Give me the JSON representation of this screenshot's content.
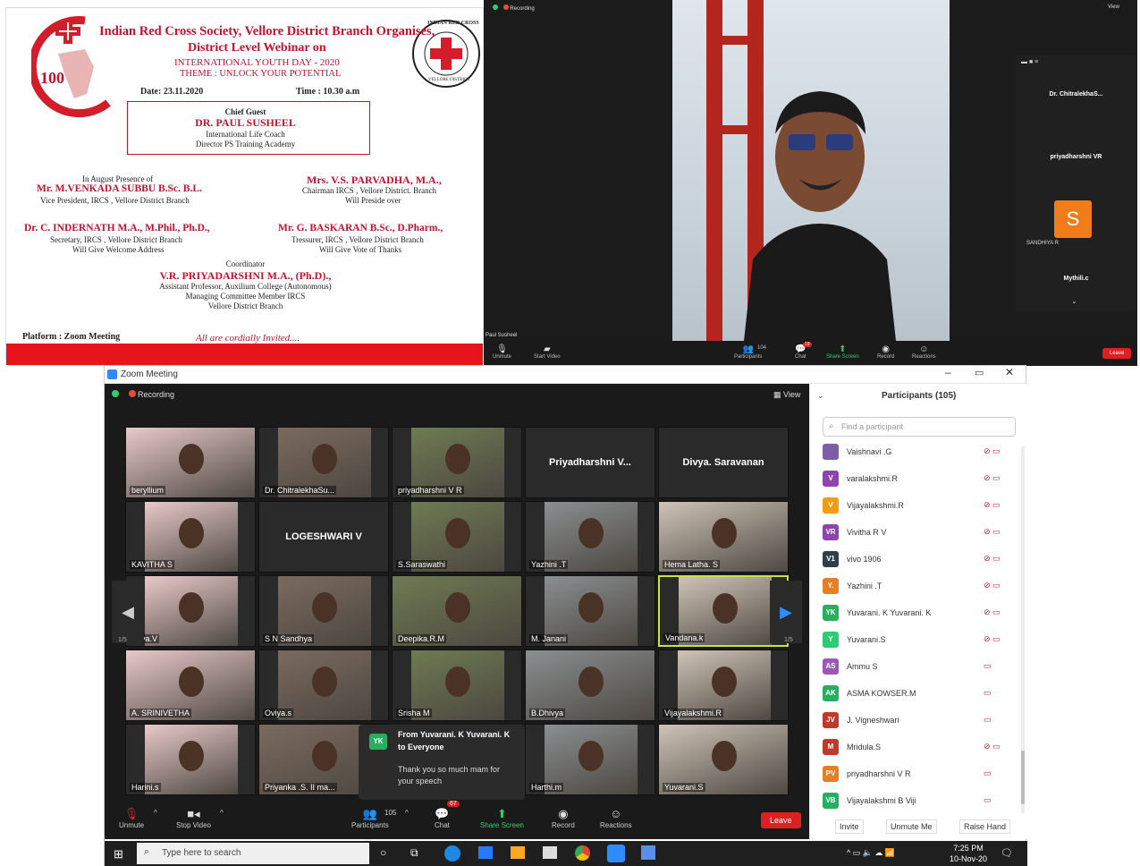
{
  "invitation": {
    "title_line1": "Indian Red Cross Society, Vellore District Branch Organises,",
    "title_line2": "District Level Webinar  on",
    "event": "INTERNATIONAL YOUTH DAY - 2020",
    "theme": "THEME : UNLOCK YOUR POTENTIAL",
    "date": "Date: 23.11.2020",
    "time": "Time : 10.30 a.m",
    "logo_text": "100",
    "seal_text_top": "INDIAN RED CROSS",
    "seal_text_bottom": "VELLORE DISTRICT",
    "chief_guest_label": "Chief Guest",
    "chief_guest_name": "DR. PAUL SUSHEEL",
    "chief_guest_role1": "International Life Coach",
    "chief_guest_role2": "Director PS Training Academy",
    "presence_label": "In August Presence of",
    "p1_name": "Mr. M.VENKADA SUBBU B.Sc. B.L.",
    "p1_role": "Vice President,  IRCS , Vellore District Branch",
    "p2_name": "Mrs. V.S. PARVADHA, M.A.,",
    "p2_role1": "Chairman IRCS ,  Vellore District. Branch",
    "p2_role2": "Will Preside over",
    "p3_name": "Dr. C. INDERNATH M.A., M.Phil., Ph.D.,",
    "p3_role1": "Secretary,  IRCS , Vellore District Branch",
    "p3_role2": "Will Give Welcome Address",
    "p4_name": "Mr. G. BASKARAN B.Sc., D.Pharm.,",
    "p4_role1": "Tressurer,  IRCS , Vellore District Branch",
    "p4_role2": "Will Give Vote of Thanks",
    "coord_label": "Coordinator",
    "coord_name": "V.R. PRIYADARSHNI M.A., (Ph.D).,",
    "coord_role1": "Assistant Professor,  Auxilium College (Autonomous)",
    "coord_role2": "Managing Committee Member IRCS",
    "coord_role3": "Vellore District Branch",
    "platform": "Platform : Zoom Meeting",
    "cordially": "All are cordially Invited...."
  },
  "zoom1": {
    "recording": "Recording",
    "view": "View",
    "speaker_name": "Paul Susheel",
    "sidebar": [
      "Dr. ChitralekhaS...",
      "priyadharshni VR",
      "SANDHIYA R",
      "Mythili.c"
    ],
    "sandhiya_initial": "S",
    "toolbar": {
      "unmute": "Unmute",
      "start_video": "Start Video",
      "participants": "Participants",
      "participants_count": "104",
      "chat": "Chat",
      "chat_badge": "19",
      "share": "Share Screen",
      "record": "Record",
      "reactions": "Reactions",
      "leave": "Leave"
    }
  },
  "zoom2": {
    "window_title": "Zoom Meeting",
    "recording": "Recording",
    "view": "View",
    "page_left": "1/5",
    "page_right": "1/5",
    "tiles": [
      {
        "name": "beryllium",
        "type": "video"
      },
      {
        "name": "Dr. ChitralekhaSu...",
        "type": "video"
      },
      {
        "name": "priyadharshni V R",
        "type": "video"
      },
      {
        "name": "Priyadharshni  V...",
        "type": "text"
      },
      {
        "name": "Divya. Saravanan",
        "type": "text"
      },
      {
        "name": "KAVITHA S",
        "type": "video"
      },
      {
        "name": "LOGESHWARI V",
        "type": "text"
      },
      {
        "name": "S.Saraswathi",
        "type": "video"
      },
      {
        "name": "Yazhini .T",
        "type": "video"
      },
      {
        "name": "Hema Latha. S",
        "type": "video"
      },
      {
        "name": "Priya.V",
        "type": "video"
      },
      {
        "name": "S N Sandhya",
        "type": "video"
      },
      {
        "name": "Deepika.R.M",
        "type": "video"
      },
      {
        "name": "M. Janani",
        "type": "video"
      },
      {
        "name": "Vandana.k",
        "type": "video"
      },
      {
        "name": "A. SRINIVETHA",
        "type": "video"
      },
      {
        "name": "Oviya.s",
        "type": "video"
      },
      {
        "name": "Srisha M",
        "type": "video"
      },
      {
        "name": "B.Dhivya",
        "type": "video"
      },
      {
        "name": "Vijayalakshmi.R",
        "type": "video"
      },
      {
        "name": "Harini.s",
        "type": "video"
      },
      {
        "name": "Priyanka .S. II ma...",
        "type": "video"
      },
      {
        "name": "",
        "type": "chat"
      },
      {
        "name": "Harthi.m",
        "type": "video"
      },
      {
        "name": "Yuvarani.S",
        "type": "video"
      }
    ],
    "chat_popup": {
      "initials": "YK",
      "from": "From Yuvarani. K Yuvarani. K",
      "to": "to Everyone",
      "message": "Thank you so much mam for your speech"
    },
    "toolbar": {
      "unmute": "Unmute",
      "stop_video": "Stop Video",
      "participants": "Participants",
      "participants_count": "105",
      "chat": "Chat",
      "chat_badge": "67",
      "share": "Share Screen",
      "record": "Record",
      "reactions": "Reactions",
      "leave": "Leave"
    },
    "participants_panel": {
      "title": "Participants (105)",
      "search_placeholder": "Find a participant",
      "rows": [
        {
          "initials": "",
          "name": "Vaishnavi .G",
          "color": "#7b5ea7"
        },
        {
          "initials": "V",
          "name": "varalakshmi.R",
          "color": "#8e44ad"
        },
        {
          "initials": "V",
          "name": "Vijayalakshmi.R",
          "color": "#f39c12"
        },
        {
          "initials": "VR",
          "name": "Vivitha R V",
          "color": "#8e44ad"
        },
        {
          "initials": "V1",
          "name": "vivo 1906",
          "color": "#2c3e50"
        },
        {
          "initials": "Y.",
          "name": "Yazhini .T",
          "color": "#e67e22"
        },
        {
          "initials": "YK",
          "name": "Yuvarani. K Yuvarani. K",
          "color": "#27ae60"
        },
        {
          "initials": "Y",
          "name": "Yuvarani.S",
          "color": "#2ecc71"
        },
        {
          "initials": "AS",
          "name": "Ammu S",
          "color": "#9b59b6"
        },
        {
          "initials": "AK",
          "name": "ASMA KOWSER.M",
          "color": "#27ae60"
        },
        {
          "initials": "JV",
          "name": "J. Vigneshwari",
          "color": "#c0392b"
        },
        {
          "initials": "M",
          "name": "Mridula.S",
          "color": "#c0392b"
        },
        {
          "initials": "PV",
          "name": "priyadharshni V R",
          "color": "#e67e22"
        },
        {
          "initials": "VB",
          "name": "Vijayalakshmi B Viji",
          "color": "#27ae60"
        }
      ],
      "invite": "Invite",
      "unmute_me": "Unmute Me",
      "raise_hand": "Raise Hand"
    },
    "taskbar": {
      "search": "Type here to search",
      "time": "7:25 PM",
      "date": "10-Nov-20"
    }
  }
}
